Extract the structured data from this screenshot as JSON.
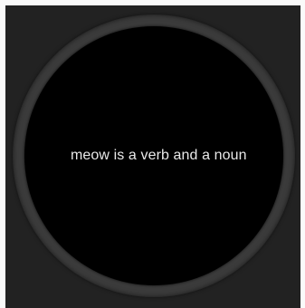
{
  "screen": {
    "message": "meow is a verb and a noun"
  }
}
